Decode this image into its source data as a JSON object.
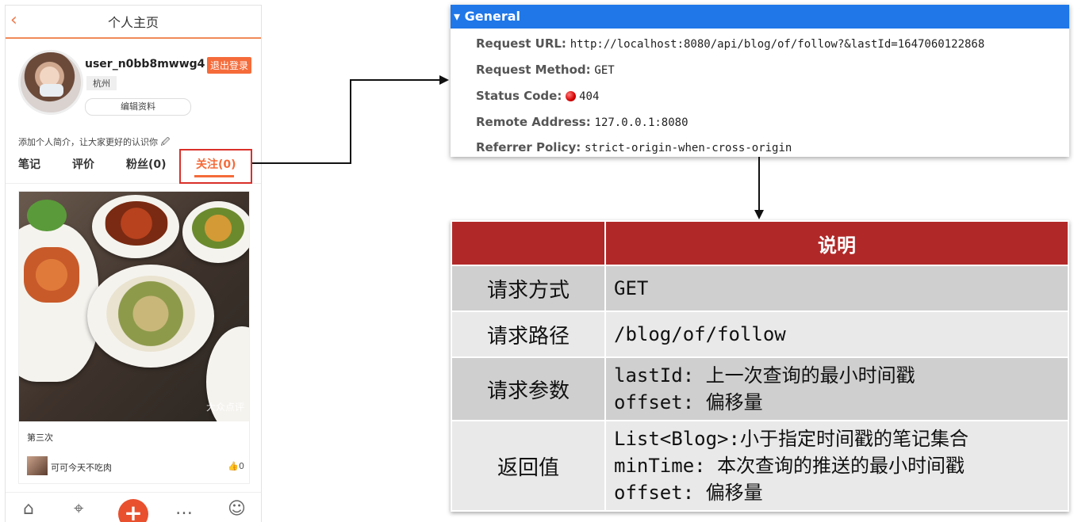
{
  "phone": {
    "nav_title": "个人主页",
    "back_icon": "chevron-left-icon",
    "username": "user_n0bb8mwwg4",
    "logout_label": "退出登录",
    "city": "杭州",
    "edit_label": "编辑资料",
    "bio": "添加个人简介，让大家更好的认识你 🖉",
    "tabs": [
      "笔记",
      "评价",
      "粉丝(0)",
      "关注(0)"
    ],
    "active_tab": "关注(0)",
    "card": {
      "title": "第三次",
      "author": "可可今天不吃肉",
      "likes": "0",
      "watermark": "大众点评"
    },
    "bottom_icons": [
      "home-icon",
      "map-pin-icon",
      "plus-icon",
      "chat-icon",
      "user-icon"
    ],
    "accent": "#f56b3a"
  },
  "devtools": {
    "section": "▾ General",
    "rows": [
      {
        "label": "Request URL:",
        "value": "http://localhost:8080/api/blog/of/follow?&lastId=1647060122868"
      },
      {
        "label": "Request Method:",
        "value": "GET"
      },
      {
        "label": "Status Code:",
        "value": "404"
      },
      {
        "label": "Remote Address:",
        "value": "127.0.0.1:8080"
      },
      {
        "label": "Referrer Policy:",
        "value": "strict-origin-when-cross-origin"
      }
    ],
    "header_color": "#1f77e8"
  },
  "table": {
    "header": [
      "",
      "说明"
    ],
    "rows": [
      {
        "key": "请求方式",
        "lines": [
          "GET"
        ]
      },
      {
        "key": "请求路径",
        "lines": [
          "/blog/of/follow"
        ]
      },
      {
        "key": "请求参数",
        "lines": [
          "lastId: 上一次查询的最小时间戳",
          "offset: 偏移量"
        ]
      },
      {
        "key": "返回值",
        "lines": [
          "List<Blog>:小于指定时间戳的笔记集合",
          "minTime: 本次查询的推送的最小时间戳",
          "offset: 偏移量"
        ]
      }
    ],
    "header_color": "#b12828"
  }
}
